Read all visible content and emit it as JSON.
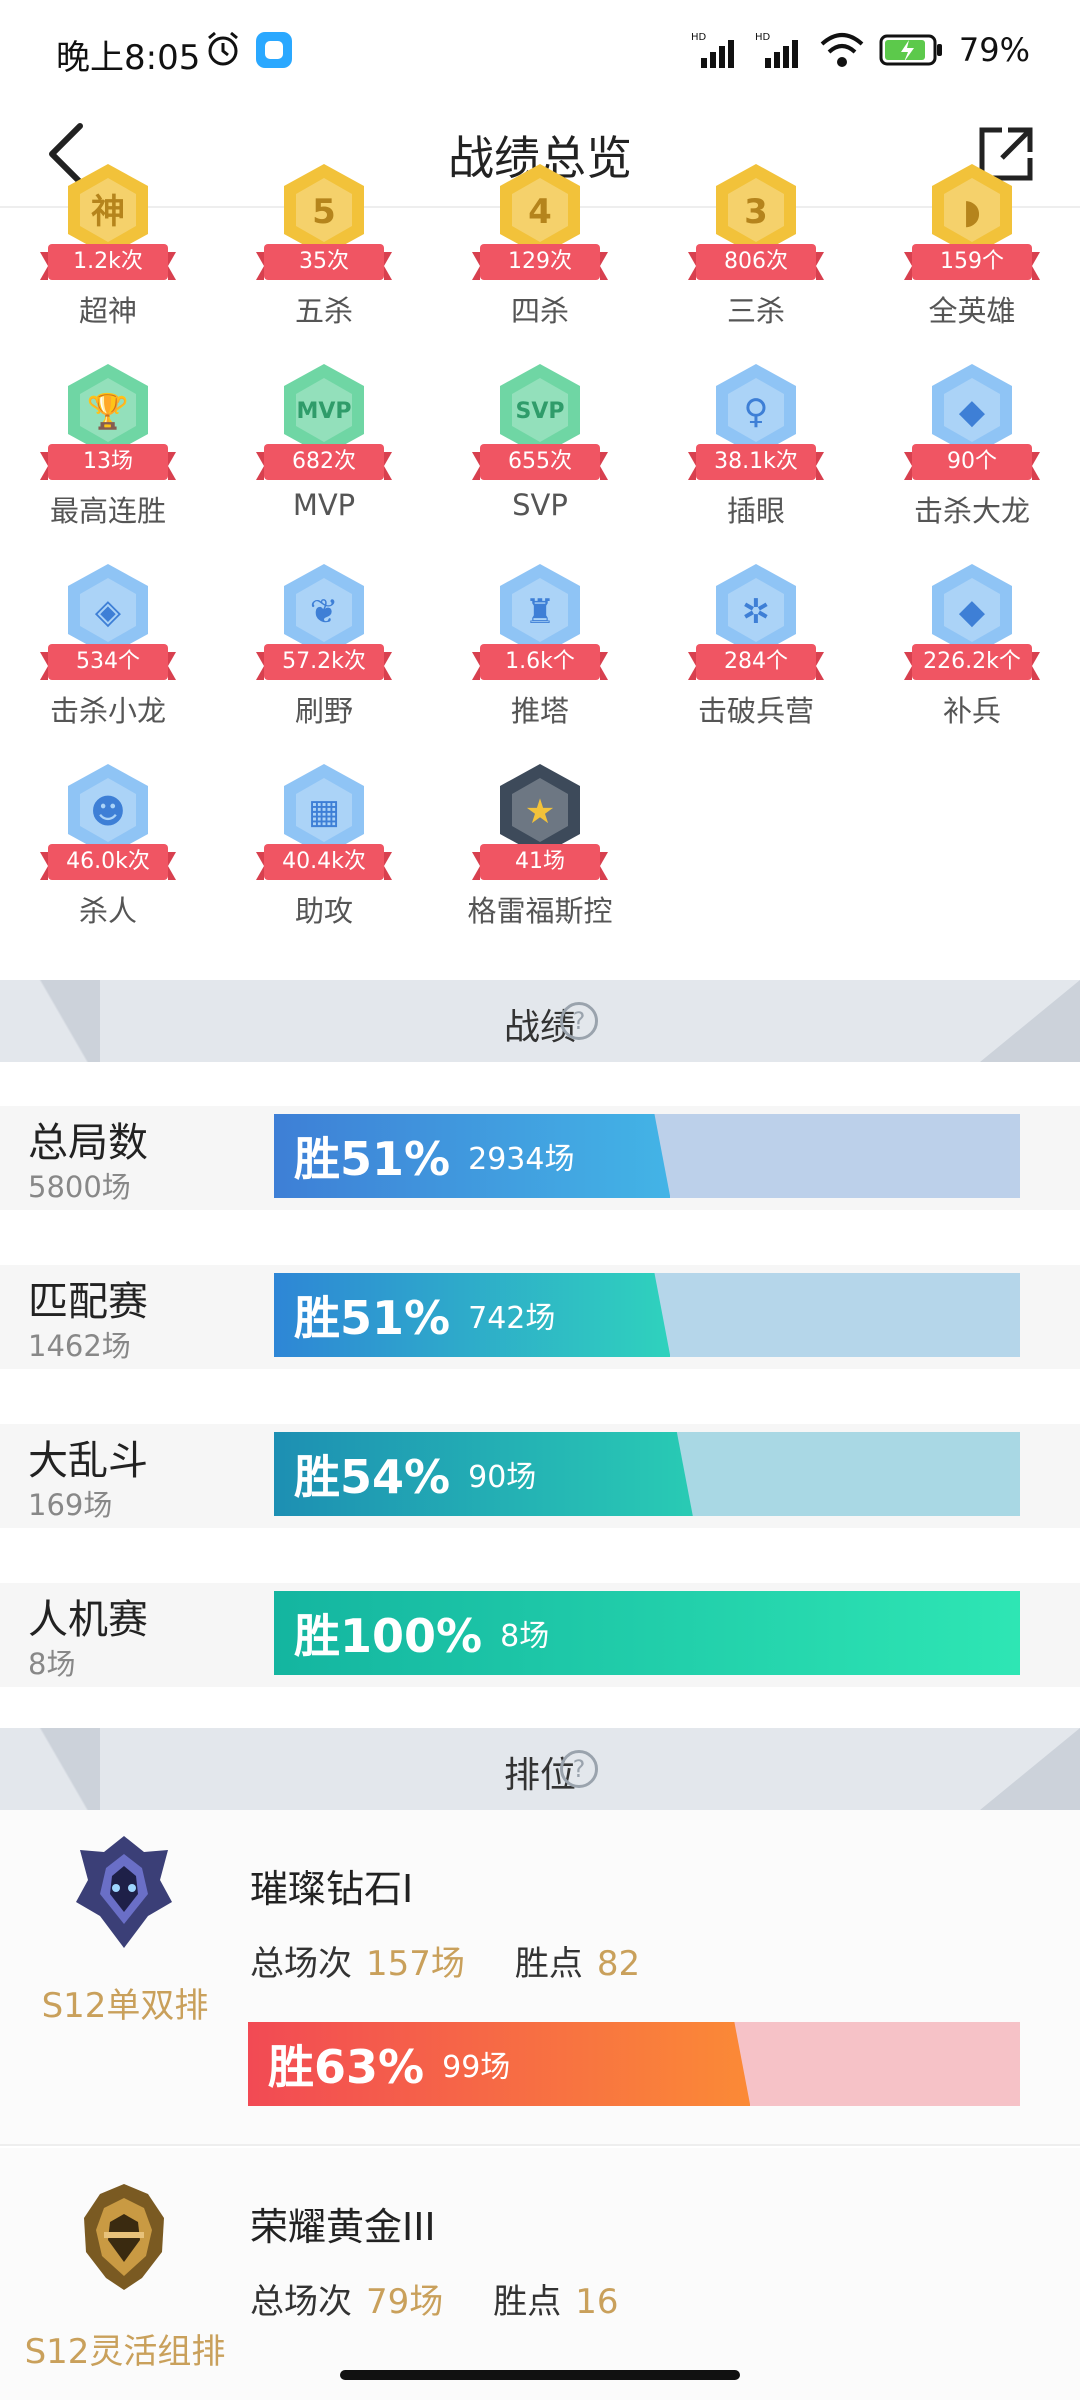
{
  "status": {
    "time": "晚上8:05",
    "battery": "79%",
    "icons": [
      "alarm-icon",
      "app-icon",
      "signal-hd-icon",
      "signal-hd-icon",
      "wifi-icon",
      "battery-charging-icon"
    ]
  },
  "header": {
    "title": "战绩总览",
    "back_icon": "chevron-left-icon",
    "share_icon": "share-icon"
  },
  "achievements": [
    {
      "label": "超神",
      "count": "1.2k次",
      "icon": "god-badge",
      "color": "#f2c23a",
      "glyph": "神"
    },
    {
      "label": "五杀",
      "count": "35次",
      "icon": "penta-badge",
      "color": "#f2c23a",
      "glyph": "5"
    },
    {
      "label": "四杀",
      "count": "129次",
      "icon": "quadra-badge",
      "color": "#f2c23a",
      "glyph": "4"
    },
    {
      "label": "三杀",
      "count": "806次",
      "icon": "triple-badge",
      "color": "#f2c23a",
      "glyph": "3"
    },
    {
      "label": "全英雄",
      "count": "159个",
      "icon": "helmet-badge",
      "color": "#f2c23a",
      "glyph": "◗"
    },
    {
      "label": "最高连胜",
      "count": "13场",
      "icon": "trophy-badge",
      "color": "#6fd6a4",
      "glyph": "🏆"
    },
    {
      "label": "MVP",
      "count": "682次",
      "icon": "mvp-badge",
      "color": "#6fd6a4",
      "glyph": "MVP"
    },
    {
      "label": "SVP",
      "count": "655次",
      "icon": "svp-badge",
      "color": "#6fd6a4",
      "glyph": "SVP"
    },
    {
      "label": "插眼",
      "count": "38.1k次",
      "icon": "ward-badge",
      "color": "#8fc4f5",
      "glyph": "♀"
    },
    {
      "label": "击杀大龙",
      "count": "90个",
      "icon": "baron-badge",
      "color": "#8fc4f5",
      "glyph": "◆"
    },
    {
      "label": "击杀小龙",
      "count": "534个",
      "icon": "dragon-badge",
      "color": "#8fc4f5",
      "glyph": "◈"
    },
    {
      "label": "刷野",
      "count": "57.2k次",
      "icon": "jungle-badge",
      "color": "#8fc4f5",
      "glyph": "❦"
    },
    {
      "label": "推塔",
      "count": "1.6k个",
      "icon": "tower-badge",
      "color": "#8fc4f5",
      "glyph": "♜"
    },
    {
      "label": "击破兵营",
      "count": "284个",
      "icon": "inhibitor-badge",
      "color": "#8fc4f5",
      "glyph": "✲"
    },
    {
      "label": "补兵",
      "count": "226.2k个",
      "icon": "minion-badge",
      "color": "#8fc4f5",
      "glyph": "◆"
    },
    {
      "label": "杀人",
      "count": "46.0k次",
      "icon": "kill-badge",
      "color": "#8fc4f5",
      "glyph": "☻"
    },
    {
      "label": "助攻",
      "count": "40.4k次",
      "icon": "assist-badge",
      "color": "#8fc4f5",
      "glyph": "▦"
    },
    {
      "label": "格雷福斯控",
      "count": "41场",
      "icon": "champion-graves-badge",
      "color": "#3d4a5a",
      "glyph": "★"
    }
  ],
  "records_section": {
    "title": "战绩"
  },
  "records": [
    {
      "name": "总局数",
      "total": "5800场",
      "win_pct": "胜51%",
      "wins": "2934场",
      "win_fraction": 0.51,
      "fill_start": "#3e7fd6",
      "fill_end": "#43b4e6",
      "track": "#bcd0ea"
    },
    {
      "name": "匹配赛",
      "total": "1462场",
      "win_pct": "胜51%",
      "wins": "742场",
      "win_fraction": 0.51,
      "fill_start": "#2e86d6",
      "fill_end": "#2fd2bd",
      "track": "#b5d6ea"
    },
    {
      "name": "大乱斗",
      "total": "169场",
      "win_pct": "胜54%",
      "wins": "90场",
      "win_fraction": 0.54,
      "fill_start": "#1d8fb3",
      "fill_end": "#29cbb4",
      "track": "#a9d8e4"
    },
    {
      "name": "人机赛",
      "total": "8场",
      "win_pct": "胜100%",
      "wins": "8场",
      "win_fraction": 1.0,
      "fill_start": "#14b5a0",
      "fill_end": "#2ee6b4",
      "track": "#a8ecd9"
    }
  ],
  "rank_section": {
    "title": "排位"
  },
  "ranks": [
    {
      "queue": "S12单双排",
      "tier": "璀璨钻石I",
      "games_label": "总场次",
      "games": "157场",
      "lp_label": "胜点",
      "lp": "82",
      "win_pct": "胜63%",
      "wins": "99场",
      "win_fraction": 0.63,
      "emblem": "diamond-emblem-icon"
    },
    {
      "queue": "S12灵活组排",
      "tier": "荣耀黄金III",
      "games_label": "总场次",
      "games": "79场",
      "lp_label": "胜点",
      "lp": "16",
      "emblem": "gold-emblem-icon"
    }
  ]
}
